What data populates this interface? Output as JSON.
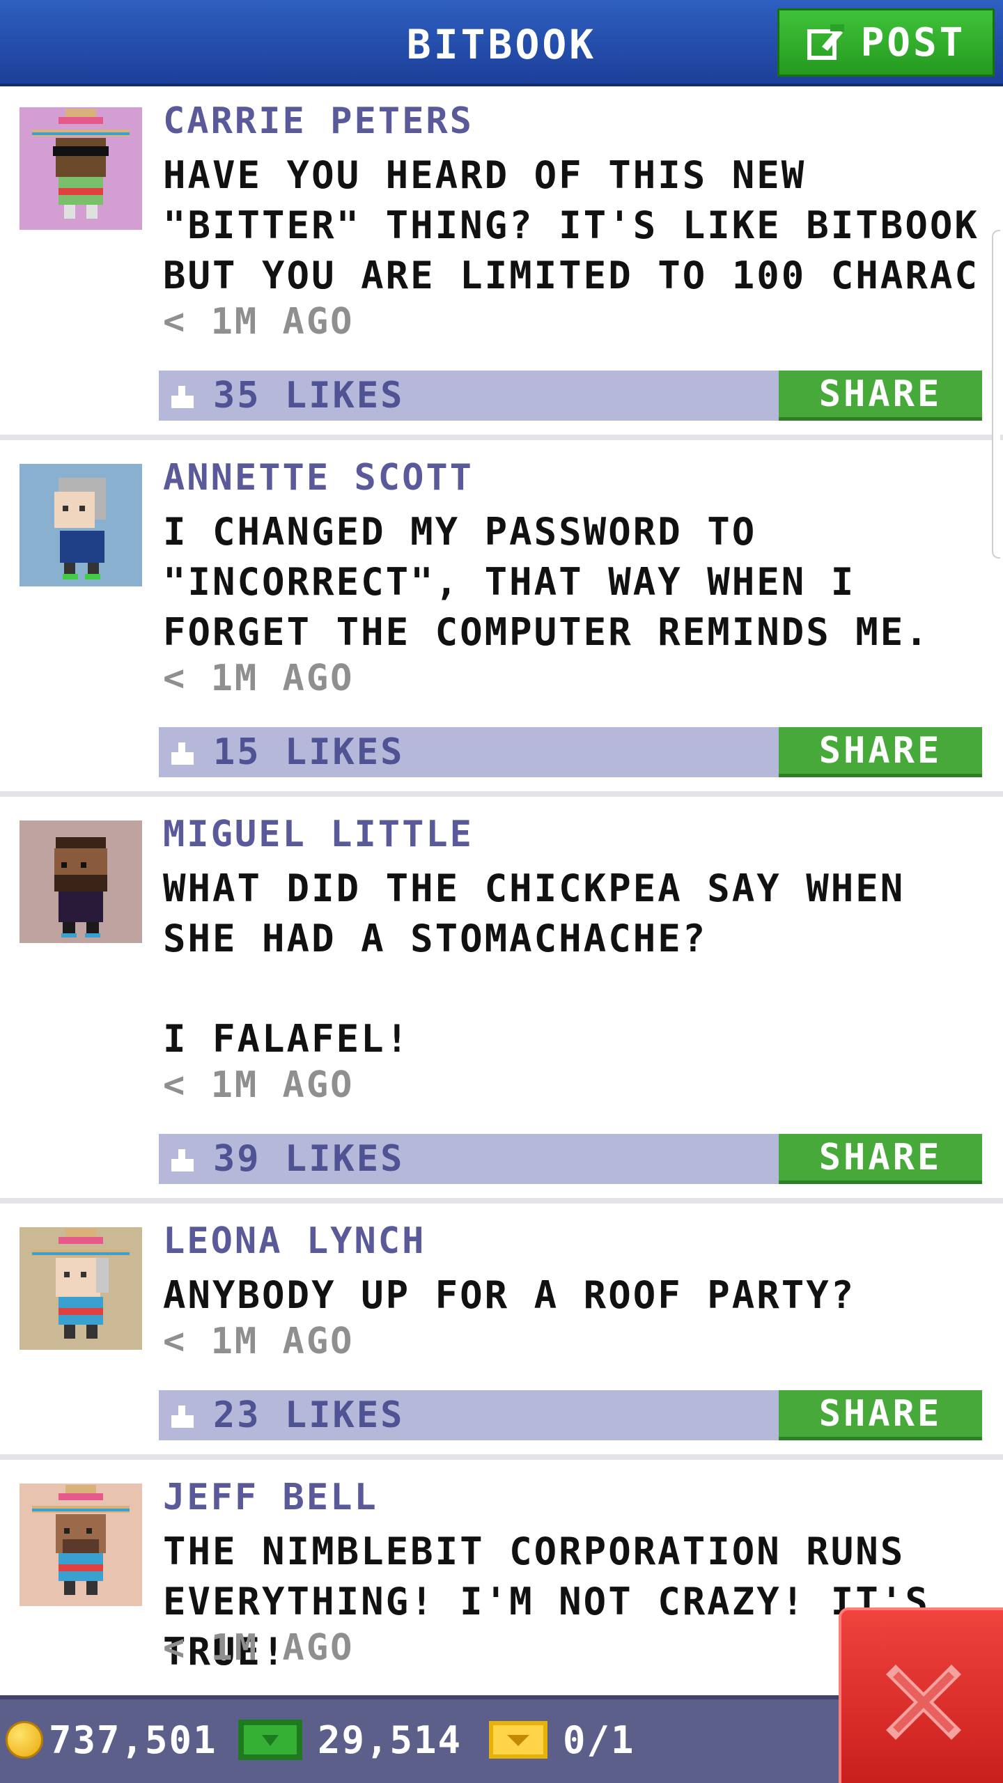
{
  "header": {
    "title": "BITBOOK",
    "post_label": "POST"
  },
  "posts": [
    {
      "author": "CARRIE PETERS",
      "message": "HAVE YOU HEARD OF THIS NEW \"BITTER\" THING? IT'S LIKE BITBOOK BUT YOU ARE LIMITED TO 100 CHARAC",
      "time": "< 1M AGO",
      "likes": "35 LIKES",
      "share": "SHARE",
      "avatar_bg": "#d39fd2"
    },
    {
      "author": "ANNETTE SCOTT",
      "message": "I CHANGED MY PASSWORD TO \"INCORRECT\", THAT WAY WHEN I FORGET THE COMPUTER REMINDS ME.",
      "time": "< 1M AGO",
      "likes": "15 LIKES",
      "share": "SHARE",
      "avatar_bg": "#8ab0cf"
    },
    {
      "author": "MIGUEL LITTLE",
      "message": "WHAT DID THE CHICKPEA SAY WHEN SHE HAD A STOMACHACHE?\n\nI FALAFEL!",
      "time": "< 1M AGO",
      "likes": "39 LIKES",
      "share": "SHARE",
      "avatar_bg": "#bea3a0"
    },
    {
      "author": "LEONA LYNCH",
      "message": "ANYBODY UP FOR A ROOF PARTY?",
      "time": "< 1M AGO",
      "likes": "23 LIKES",
      "share": "SHARE",
      "avatar_bg": "#cbb894"
    },
    {
      "author": "JEFF BELL",
      "message": "THE NIMBLEBIT CORPORATION RUNS EVERYTHING! I'M NOT CRAZY! IT'S TRUE!",
      "time": "< 1M AGO",
      "likes": "",
      "share": "",
      "avatar_bg": "#e8c3b0"
    }
  ],
  "stats": {
    "coins": "737,501",
    "bux": "29,514",
    "tickets": "0/1"
  },
  "colors": {
    "header_blue": "#2e5fc0",
    "post_green": "#3fc239",
    "share_green": "#46a93a",
    "likes_bar": "#b6b8da",
    "author_purple": "#5a5a9a",
    "bottom_bar": "#5d5f8b",
    "close_red": "#e0302c"
  }
}
